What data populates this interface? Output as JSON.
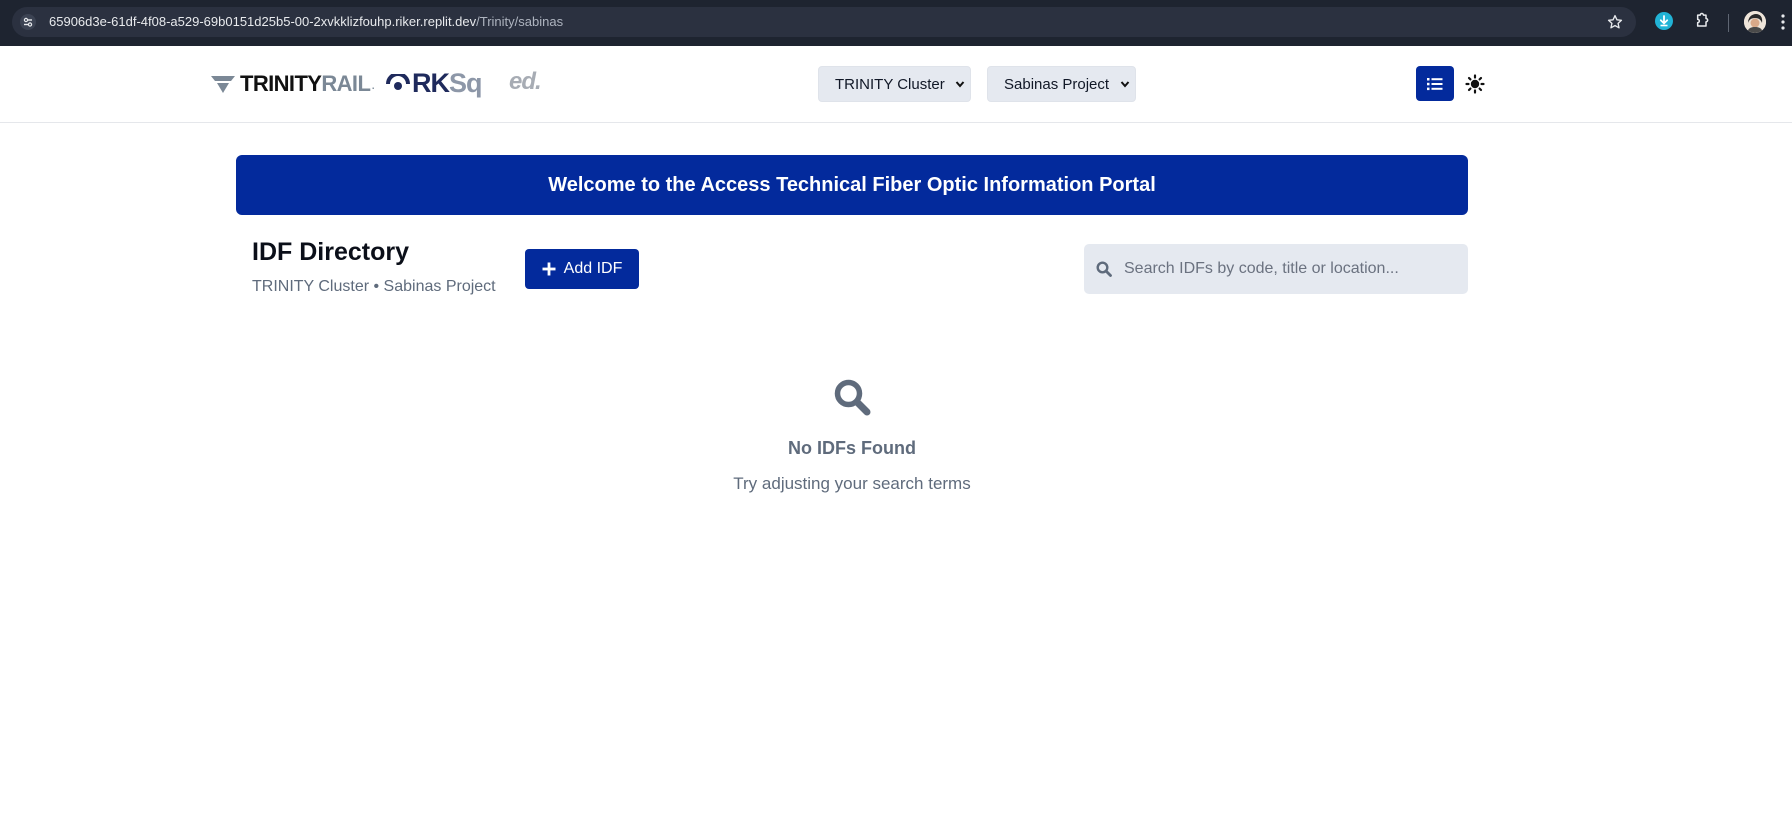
{
  "browser": {
    "url_host": "65906d3e-61df-4f08-a529-69b0151d25b5-00-2xvkklizfouhp.riker.replit.dev",
    "url_path": "/Trinity/sabinas",
    "icons": [
      "tune-icon",
      "star-icon",
      "download-extension-icon",
      "puzzle-icon",
      "profile-avatar",
      "kebab-menu-icon"
    ]
  },
  "header": {
    "logos": {
      "trinity_a": "TRINITY",
      "trinity_b": "RAIL",
      "trinity_dot": ".",
      "rksq_a": "RK",
      "rksq_b": "Sq",
      "ed": "ed."
    },
    "cluster_select": {
      "selected": "TRINITY Cluster"
    },
    "project_select": {
      "selected": "Sabinas Project"
    },
    "icons": [
      "list-icon",
      "sun-icon"
    ]
  },
  "banner": {
    "text": "Welcome to the Access Technical Fiber Optic Information Portal"
  },
  "directory": {
    "title": "IDF Directory",
    "subtitle": "TRINITY Cluster • Sabinas Project",
    "add_button_label": "Add IDF",
    "search_placeholder": "Search IDFs by code, title or location...",
    "search_value": ""
  },
  "empty_state": {
    "title": "No IDFs Found",
    "hint": "Try adjusting your search terms"
  },
  "colors": {
    "brand_blue": "#032a9c",
    "chrome_dark": "#1e2430",
    "input_bg": "#e5e9f0",
    "muted_text": "#5f6b7c"
  }
}
